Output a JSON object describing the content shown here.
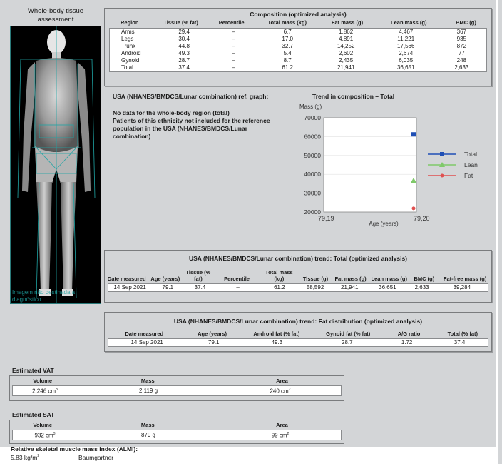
{
  "scan": {
    "title": "Whole-body tissue assessment",
    "watermark": "Imagem não destinada a diagnóstico"
  },
  "composition": {
    "title": "Composition (optimized analysis)",
    "headers": [
      "Region",
      "Tissue (% fat)",
      "Percentile",
      "Total mass (kg)",
      "Fat mass (g)",
      "Lean mass (g)",
      "BMC (g)"
    ],
    "rows": [
      [
        "Arms",
        "29.4",
        "–",
        "6.7",
        "1,862",
        "4,467",
        "367"
      ],
      [
        "Legs",
        "30.4",
        "–",
        "17.0",
        "4,891",
        "11,221",
        "935"
      ],
      [
        "Trunk",
        "44.8",
        "–",
        "32.7",
        "14,252",
        "17,566",
        "872"
      ],
      [
        "Android",
        "49.3",
        "–",
        "5.4",
        "2,602",
        "2,674",
        "77"
      ],
      [
        "Gynoid",
        "28.7",
        "–",
        "8.7",
        "2,435",
        "6,035",
        "248"
      ],
      [
        "Total",
        "37.4",
        "–",
        "61.2",
        "21,941",
        "36,651",
        "2,633"
      ]
    ]
  },
  "reference": {
    "title": "USA (NHANES/BMDCS/Lunar combination) ref. graph:",
    "line1": "No data for the whole-body region (total)",
    "line2": "Patients of this ethnicity not included for the reference",
    "line3": "population in the USA (NHANES/BMDCS/Lunar",
    "line4": "combination)"
  },
  "chart_data": {
    "type": "scatter",
    "title": "Trend in composition – Total",
    "ylabel": "Mass (g)",
    "xlabel": "Age (years)",
    "ylim": [
      20000,
      70000
    ],
    "yticks": [
      "70000",
      "60000",
      "50000",
      "40000",
      "30000",
      "20000"
    ],
    "xticks": [
      "79,19",
      "79,20"
    ],
    "series": [
      {
        "name": "Total",
        "x": 79.2,
        "y": 61200,
        "color": "#1f4fb5",
        "marker": "square"
      },
      {
        "name": "Lean",
        "x": 79.2,
        "y": 36651,
        "color": "#7fc96a",
        "marker": "triangle"
      },
      {
        "name": "Fat",
        "x": 79.2,
        "y": 21941,
        "color": "#e05050",
        "marker": "circle"
      }
    ]
  },
  "trend_total": {
    "title": "USA (NHANES/BMDCS/Lunar combination) trend: Total (optimized analysis)",
    "headers": [
      "Date measured",
      "Age (years)",
      "Tissue (% fat)",
      "Percentile",
      "Total mass (kg)",
      "Tissue (g)",
      "Fat mass (g)",
      "Lean mass (g)",
      "BMC (g)",
      "Fat-free mass (g)"
    ],
    "row": [
      "14 Sep 2021",
      "79.1",
      "37.4",
      "–",
      "61.2",
      "58,592",
      "21,941",
      "36,651",
      "2,633",
      "39,284"
    ]
  },
  "trend_fat": {
    "title": "USA (NHANES/BMDCS/Lunar combination) trend: Fat distribution (optimized analysis)",
    "headers": [
      "Date measured",
      "Age (years)",
      "Android fat (% fat)",
      "Gynoid fat (% fat)",
      "A/G ratio",
      "Total (% fat)"
    ],
    "row": [
      "14 Sep 2021",
      "79.1",
      "49.3",
      "28.7",
      "1.72",
      "37.4"
    ]
  },
  "vat": {
    "label": "Estimated VAT",
    "headers": [
      "Volume",
      "Mass",
      "Area"
    ],
    "volume": "2,246 cm",
    "mass": "2,119 g",
    "area": "240 cm",
    "volume_sup": "3",
    "area_sup": "2"
  },
  "sat": {
    "label": "Estimated SAT",
    "headers": [
      "Volume",
      "Mass",
      "Area"
    ],
    "volume": "932 cm",
    "mass": "879 g",
    "area": "99 cm",
    "volume_sup": "3",
    "area_sup": "2"
  },
  "almi": {
    "label": "Relative skeletal muscle mass index (ALMI):",
    "value": "5.83 kg/m",
    "value_sup": "2",
    "method": "Baumgartner"
  }
}
